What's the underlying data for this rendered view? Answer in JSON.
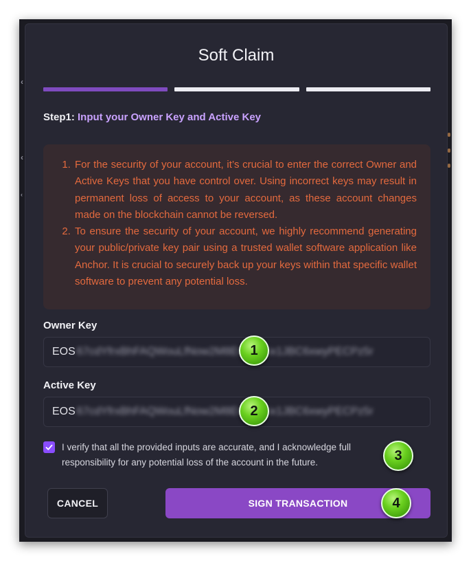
{
  "modal": {
    "title": "Soft Claim",
    "steps": [
      {
        "active": true,
        "color": "#7f4bbf"
      },
      {
        "active": false,
        "color": "#ececf2"
      },
      {
        "active": false,
        "color": "#ececf2"
      }
    ],
    "step_heading_prefix": "Step1:",
    "step_heading_text": "Input your Owner Key and Active Key",
    "warnings": [
      "For the security of your account, it’s crucial to enter the correct Owner and Active Keys that you have control over. Using incorrect keys may result in permanent loss of access to your account, as these account changes made on the blockchain cannot be reversed.",
      "To ensure the security of your account, we highly recommend generating your public/private key pair using a trusted wallet software application like Anchor. It is crucial to securely back up your keys within that specific wallet software to prevent any potential loss."
    ],
    "owner_key": {
      "label": "Owner Key",
      "prefix": "EOS",
      "blurred_value": "67cdYfrxBhFAQWouLfNow2M8Evvwkuix1JBC6xwyPECPz5r"
    },
    "active_key": {
      "label": "Active Key",
      "prefix": "EOS",
      "blurred_value": "67cdYfrxBhFAQWouLfNow2M8Evvwkuix1JBC6xwyPECPz5r"
    },
    "verify": {
      "checked": true,
      "text": "I verify that all the provided inputs are accurate, and I acknowledge full responsibility for any potential loss of the account in the future."
    },
    "buttons": {
      "cancel": "CANCEL",
      "sign": "SIGN TRANSACTION"
    }
  },
  "annotations": [
    "1",
    "2",
    "3",
    "4"
  ],
  "colors": {
    "accent": "#8a48c5",
    "checkbox": "#8a4dff",
    "warning_text": "#e46a3e",
    "step_text": "#c9a2ff"
  }
}
